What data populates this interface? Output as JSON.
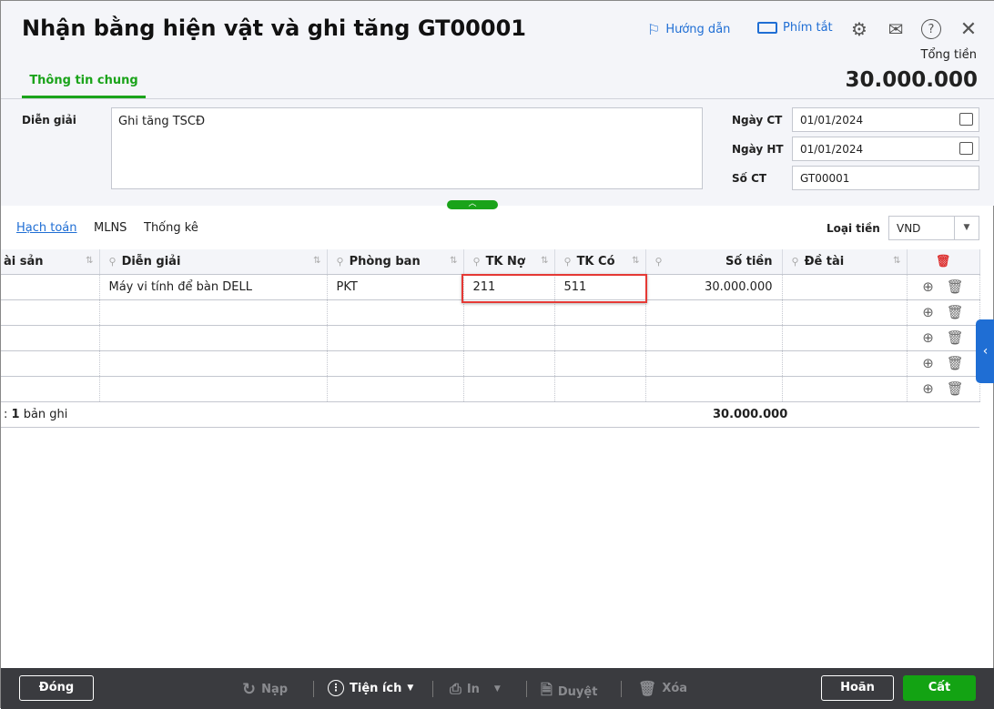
{
  "header": {
    "title": "Nhận bằng hiện vật và ghi tăng GT00001",
    "guide": "Hướng dẫn",
    "shortcuts": "Phím tắt",
    "total_label": "Tổng tiền",
    "total_value": "30.000.000"
  },
  "tabs": {
    "general": "Thông tin chung"
  },
  "form": {
    "desc_label": "Diễn giải",
    "desc_value": "Ghi tăng TSCĐ",
    "date_ct_label": "Ngày CT",
    "date_ct": "01/01/2024",
    "date_ht_label": "Ngày HT",
    "date_ht": "01/01/2024",
    "so_ct_label": "Số CT",
    "so_ct": "GT00001"
  },
  "subtabs": [
    "Hạch toán",
    "MLNS",
    "Thống kê"
  ],
  "currency": {
    "label": "Loại tiền",
    "value": "VND"
  },
  "table": {
    "columns": [
      "ài sản",
      "Diễn giải",
      "Phòng ban",
      "TK Nợ",
      "TK Có",
      "Số tiền",
      "Đề tài"
    ],
    "rows": [
      {
        "asset": "",
        "desc": "Máy vi tính để bàn DELL",
        "dept": "PKT",
        "debit": "211",
        "credit": "511",
        "amount": "30.000.000",
        "topic": ""
      }
    ],
    "footer_count": "1",
    "footer_text": "bản ghi",
    "footer_prefix": ":",
    "footer_total": "30.000.000"
  },
  "toolbar": {
    "close": "Đóng",
    "reload": "Nạp",
    "utilities": "Tiện ích",
    "print": "In",
    "approve": "Duyệt",
    "delete": "Xóa",
    "cancel": "Hoãn",
    "save": "Cất"
  }
}
